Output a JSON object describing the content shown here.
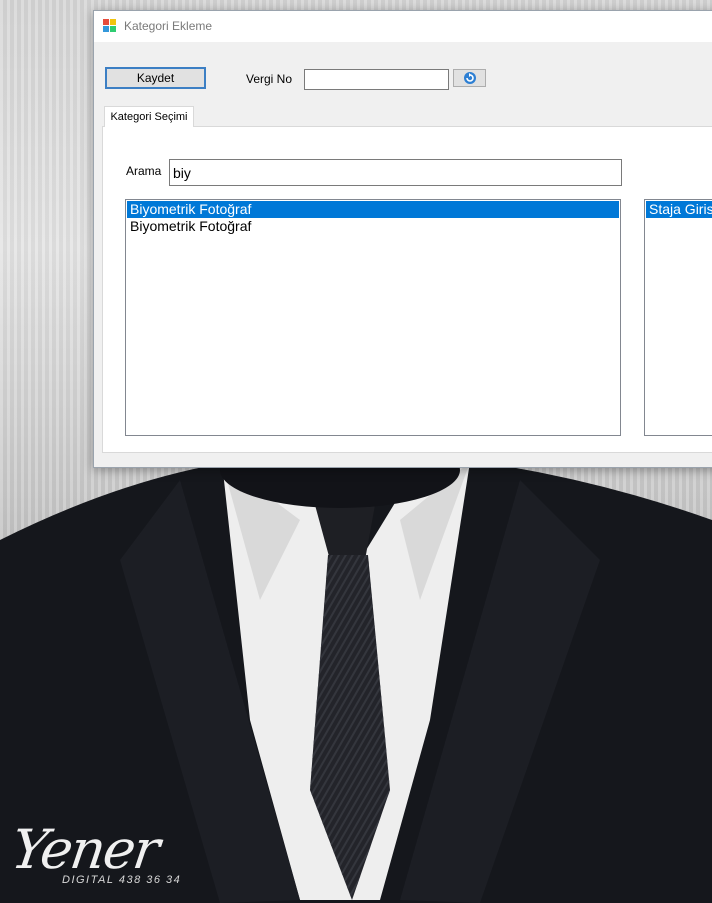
{
  "window": {
    "title": "Kategori Ekleme"
  },
  "toolbar": {
    "save_label": "Kaydet",
    "vergi_label": "Vergi No",
    "vergi_value": ""
  },
  "tabs": [
    {
      "label": "Kategori Seçimi",
      "active": true
    }
  ],
  "search": {
    "label": "Arama",
    "value": "biy"
  },
  "list_left": {
    "items": [
      {
        "label": "Biyometrik Fotoğraf",
        "selected": true
      },
      {
        "label": "Biyometrik Fotoğraf",
        "selected": false
      }
    ]
  },
  "list_right": {
    "items": [
      {
        "label": "Staja Giris",
        "selected": true
      }
    ]
  },
  "background": {
    "logo_text": "Yener",
    "logo_sub": "DIGITAL 438 36 34"
  },
  "colors": {
    "selection": "#0078d7",
    "focus_border": "#3c7fc4",
    "window_bg": "#f0f0f0"
  },
  "icons": {
    "app": "app-grid-icon",
    "refresh": "refresh-icon"
  }
}
